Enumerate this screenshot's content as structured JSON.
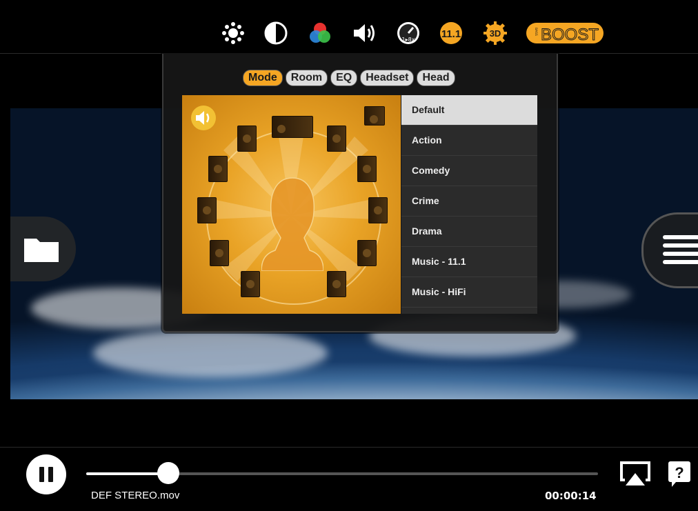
{
  "toolbar": {
    "icons": [
      "brightness-icon",
      "contrast-icon",
      "color-icon",
      "volume-icon",
      "speed-icon",
      "surround-11-1-icon",
      "3d-icon",
      "bass-boost-icon"
    ],
    "speed_text": "1▸8x",
    "surround_text": "11.1",
    "threed_text": "3D",
    "bass_small": "BASS",
    "bass_text": "BOOST",
    "accent": "#f5a623"
  },
  "tabs": [
    {
      "label": "Mode"
    },
    {
      "label": "Room"
    },
    {
      "label": "EQ"
    },
    {
      "label": "Headset"
    },
    {
      "label": "Head"
    }
  ],
  "modes": [
    {
      "label": "Default"
    },
    {
      "label": "Action"
    },
    {
      "label": "Comedy"
    },
    {
      "label": "Crime"
    },
    {
      "label": "Drama"
    },
    {
      "label": "Music - 11.1"
    },
    {
      "label": "Music - HiFi"
    }
  ],
  "player": {
    "filename": "DEF STEREO.mov",
    "time": "00:00:14",
    "progress": 0.16
  }
}
